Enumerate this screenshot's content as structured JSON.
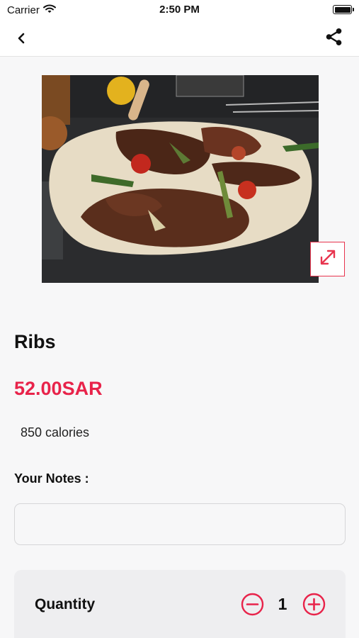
{
  "status_bar": {
    "carrier": "Carrier",
    "time": "2:50 PM",
    "icons": [
      "wifi-icon",
      "battery-icon"
    ]
  },
  "nav_bar": {
    "icons": [
      "chevron-left-icon",
      "share-icon"
    ]
  },
  "product": {
    "name": "Ribs",
    "price": "52.00SAR",
    "calories": "850 calories",
    "image_icon": "expand-icon"
  },
  "notes": {
    "label": "Your Notes :",
    "value": "",
    "placeholder": ""
  },
  "quantity": {
    "label": "Quantity",
    "value": "1",
    "icons": [
      "minus-circle-icon",
      "plus-circle-icon"
    ]
  },
  "colors": {
    "accent": "#e8234a",
    "background": "#f7f7f8",
    "card": "#eeeef0"
  }
}
